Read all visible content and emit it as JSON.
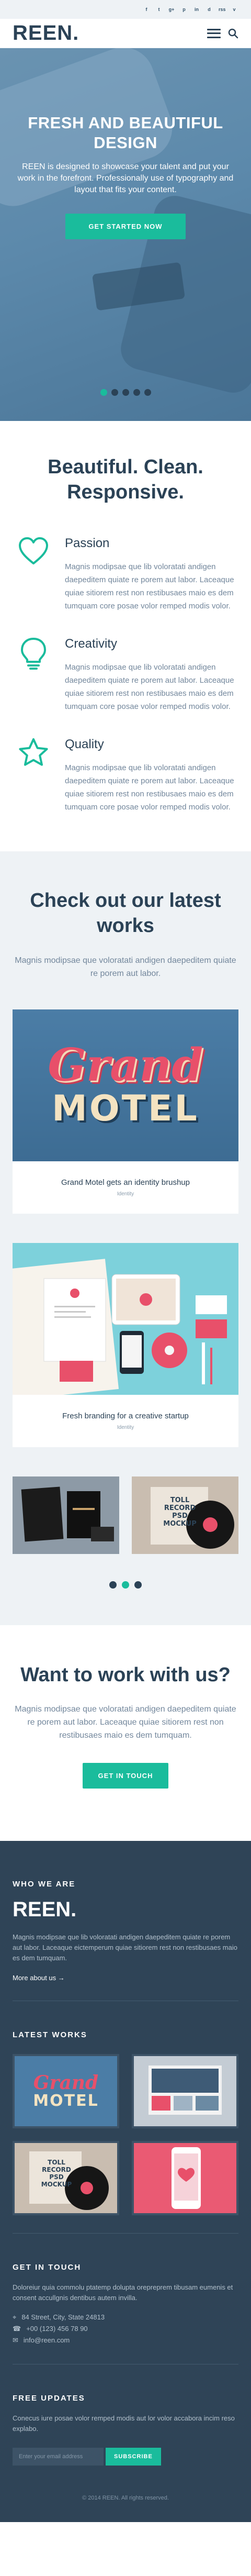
{
  "topbar": {
    "social": [
      "f",
      "t",
      "g+",
      "p",
      "in",
      "d",
      "rss",
      "v"
    ]
  },
  "header": {
    "logo": "REEN."
  },
  "hero": {
    "title": "FRESH AND BEAUTIFUL DESIGN",
    "text": "REEN is designed to showcase your talent and put your work in the forefront. Professionally use of typography and layout that fits your content.",
    "cta": "GET STARTED NOW",
    "slides": 5,
    "active_slide": 1
  },
  "features": {
    "heading": "Beautiful. Clean. Responsive.",
    "items": [
      {
        "icon": "heart-icon",
        "title": "Passion",
        "text": "Magnis modipsae que lib voloratati andigen daepeditem quiate re porem aut labor. Laceaque quiae sitiorem rest non restibusaes maio es dem tumquam core posae volor remped modis volor."
      },
      {
        "icon": "lightbulb-icon",
        "title": "Creativity",
        "text": "Magnis modipsae que lib voloratati andigen daepeditem quiate re porem aut labor. Laceaque quiae sitiorem rest non restibusaes maio es dem tumquam core posae volor remped modis volor."
      },
      {
        "icon": "star-icon",
        "title": "Quality",
        "text": "Magnis modipsae que lib voloratati andigen daepeditem quiate re porem aut labor. Laceaque quiae sitiorem rest non restibusaes maio es dem tumquam core posae volor remped modis volor."
      }
    ]
  },
  "works": {
    "heading": "Check out our latest works",
    "intro": "Magnis modipsae que voloratati andigen daepeditem quiate re porem aut labor.",
    "cards": [
      {
        "title": "Grand Motel gets an identity brushup",
        "tag": "Identity",
        "art_word1": "Grand",
        "art_word2": "MOTEL"
      },
      {
        "title": "Fresh branding for a creative startup",
        "tag": "Identity"
      }
    ],
    "thumb_text": "TOLL RECORD PSD MOCKUP",
    "slides": 3,
    "active_slide": 2
  },
  "cta": {
    "heading": "Want to work with us?",
    "text": "Magnis modipsae que voloratati andigen daepeditem quiate re porem aut labor. Laceaque quiae sitiorem rest non restibusaes maio es dem tumquam.",
    "button": "GET IN TOUCH"
  },
  "footer": {
    "who_heading": "WHO WE ARE",
    "logo": "REEN.",
    "about": "Magnis modipsae que lib voloratati andigen daepeditem quiate re porem aut labor. Laceaque eictemperum quiae sitiorem rest non restibusaes maio es dem tumquam.",
    "more": "More about us →",
    "latest_heading": "LATEST WORKS",
    "thumb_art_word1": "Grand",
    "thumb_art_word2": "MOTEL",
    "thumb_text": "TOLL RECORD PSD MOCKUP",
    "touch_heading": "GET IN TOUCH",
    "touch_text": "Doloreiur quia commolu ptatemp dolupta orepreprem tibusam eumenis et consent accullgnis dentibus autem invilla.",
    "address": "84 Street, City, State 24813",
    "phone": "+00 (123) 456 78 90",
    "email": "info@reen.com",
    "updates_heading": "FREE UPDATES",
    "updates_text": "Conecus iure posae volor remped modis aut lor volor accabora incim reso explabo.",
    "email_placeholder": "Enter your email address",
    "subscribe": "SUBSCRIBE",
    "copyright": "© 2014 REEN. All rights reserved."
  },
  "colors": {
    "accent": "#1abc9c",
    "heading": "#2b4256",
    "text": "#73879c",
    "footer_bg": "#2f4457",
    "light_bg": "#eef2f5"
  }
}
